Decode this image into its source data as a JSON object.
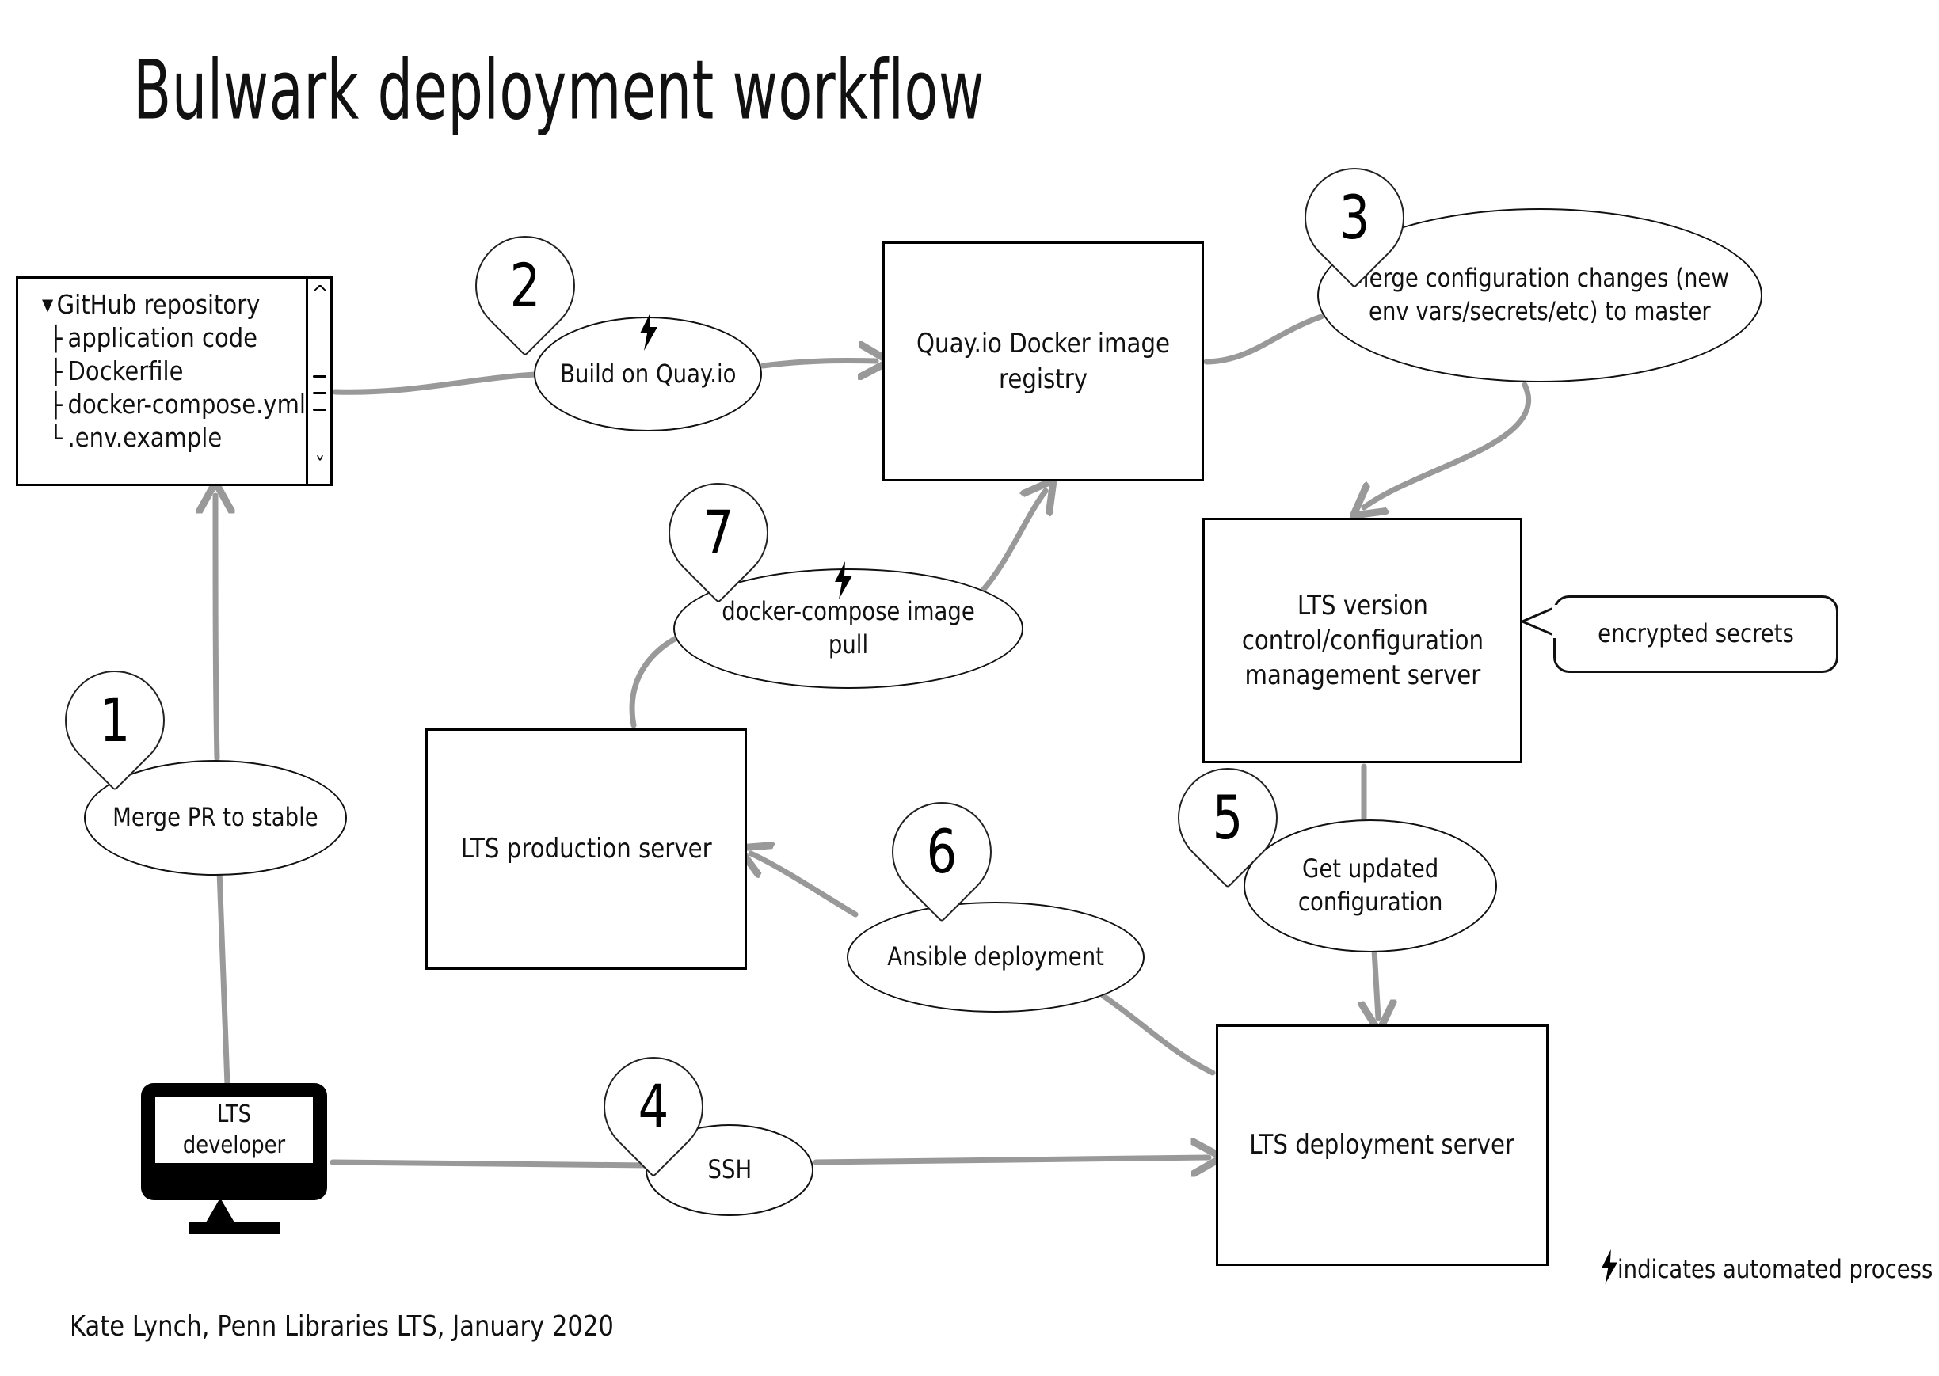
{
  "title": "Bulwark deployment workflow",
  "credit": "Kate Lynch, Penn Libraries LTS, January 2020",
  "legend": {
    "bolt_icon": "lightning-bolt-icon",
    "text": "indicates automated process"
  },
  "colors": {
    "ink": "#111111",
    "edge": "#999999",
    "background": "#ffffff",
    "monitor": "#000000"
  },
  "repository": {
    "root_label": "GitHub repository",
    "disclosure_icon": "triangle-down-icon",
    "files": [
      "application code",
      "Dockerfile",
      "docker-compose.yml",
      ".env.example"
    ],
    "scrollbar": {
      "up_icon": "chevron-up-icon",
      "down_icon": "chevron-down-icon",
      "grip_icon": "scrollbar-grip-icon"
    }
  },
  "nodes": {
    "quay_registry": "Quay.io Docker image\nregistry",
    "vcs_server": "LTS version\ncontrol/configuration\nmanagement server",
    "production_server": "LTS production server",
    "deployment_server": "LTS deployment server",
    "developer": "LTS developer",
    "encrypted_secrets": "encrypted secrets"
  },
  "steps": [
    {
      "number": "1",
      "label": "Merge PR to stable",
      "automated": false
    },
    {
      "number": "2",
      "label": "Build on Quay.io",
      "automated": true
    },
    {
      "number": "3",
      "label": "Merge configuration changes (new\nenv vars/secrets/etc) to master",
      "automated": false
    },
    {
      "number": "4",
      "label": "SSH",
      "automated": false
    },
    {
      "number": "5",
      "label": "Get updated\nconfiguration",
      "automated": false
    },
    {
      "number": "6",
      "label": "Ansible deployment",
      "automated": false
    },
    {
      "number": "7",
      "label": "docker-compose image pull",
      "automated": true
    }
  ]
}
